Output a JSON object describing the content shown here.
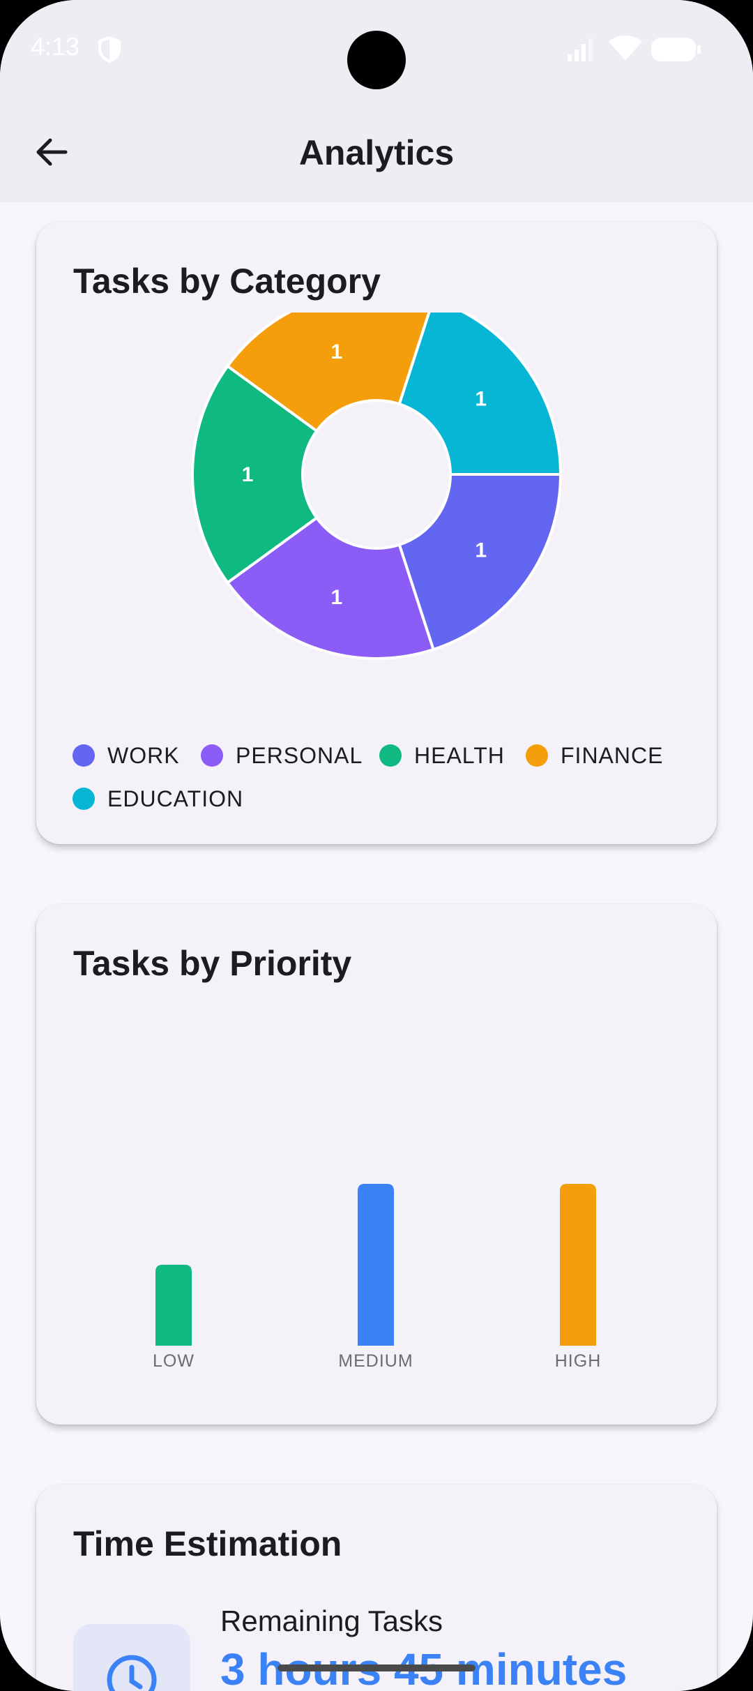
{
  "status_bar": {
    "time": "4:13"
  },
  "app_bar": {
    "title": "Analytics"
  },
  "category_card": {
    "title": "Tasks by Category",
    "legend": [
      {
        "label": "WORK",
        "color": "#6366f1"
      },
      {
        "label": "PERSONAL",
        "color": "#8b5cf6"
      },
      {
        "label": "HEALTH",
        "color": "#10b981"
      },
      {
        "label": "FINANCE",
        "color": "#f59e0b"
      },
      {
        "label": "EDUCATION",
        "color": "#06b6d4"
      }
    ]
  },
  "priority_card": {
    "title": "Tasks by Priority"
  },
  "time_card": {
    "title": "Time Estimation",
    "remaining_label": "Remaining Tasks",
    "remaining_value": "3 hours 45 minutes",
    "icon": "clock-icon"
  },
  "chart_data": [
    {
      "type": "pie",
      "title": "Tasks by Category",
      "labels": [
        "WORK",
        "PERSONAL",
        "HEALTH",
        "FINANCE",
        "EDUCATION"
      ],
      "values": [
        1,
        1,
        1,
        1,
        1
      ],
      "colors": [
        "#6366f1",
        "#8b5cf6",
        "#10b981",
        "#f59e0b",
        "#06b6d4"
      ],
      "donut": true,
      "legend": "bottom"
    },
    {
      "type": "bar",
      "title": "Tasks by Priority",
      "categories": [
        "LOW",
        "MEDIUM",
        "HIGH"
      ],
      "values": [
        1,
        2,
        2
      ],
      "colors": [
        "#10b981",
        "#3b82f6",
        "#f59e0b"
      ],
      "grid": false
    }
  ]
}
